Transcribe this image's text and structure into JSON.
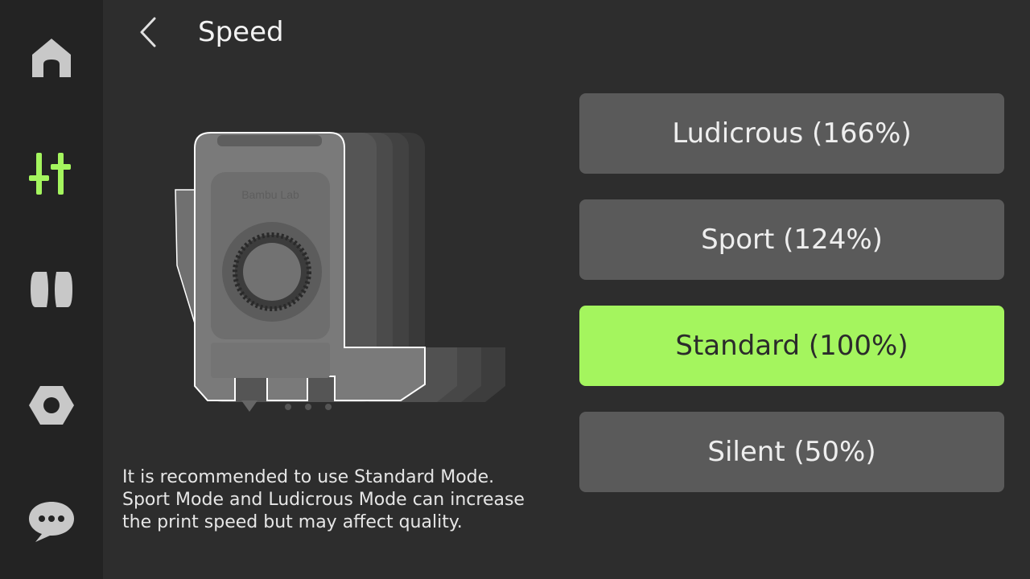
{
  "colors": {
    "accent": "#a4f55e",
    "sidebar_bg": "#232323",
    "main_bg": "#2d2d2d",
    "button_bg": "#5a5a5a",
    "icon_inactive": "#c8c8c8"
  },
  "sidebar": {
    "items": [
      {
        "icon": "home-icon",
        "active": false
      },
      {
        "icon": "controls-icon",
        "active": true
      },
      {
        "icon": "filament-spool-icon",
        "active": false
      },
      {
        "icon": "settings-nut-icon",
        "active": false
      },
      {
        "icon": "chat-icon",
        "active": false
      }
    ]
  },
  "header": {
    "back_icon": "chevron-left-icon",
    "title": "Speed"
  },
  "illustration": {
    "brand_text": "Bambu Lab"
  },
  "description": {
    "lines": [
      "It is recommended to use Standard Mode.",
      "Sport Mode and Ludicrous Mode can increase",
      "the print speed but may affect quality."
    ]
  },
  "modes": [
    {
      "label": "Ludicrous (166%)",
      "selected": false
    },
    {
      "label": "Sport (124%)",
      "selected": false
    },
    {
      "label": "Standard (100%)",
      "selected": true
    },
    {
      "label": "Silent (50%)",
      "selected": false
    }
  ]
}
